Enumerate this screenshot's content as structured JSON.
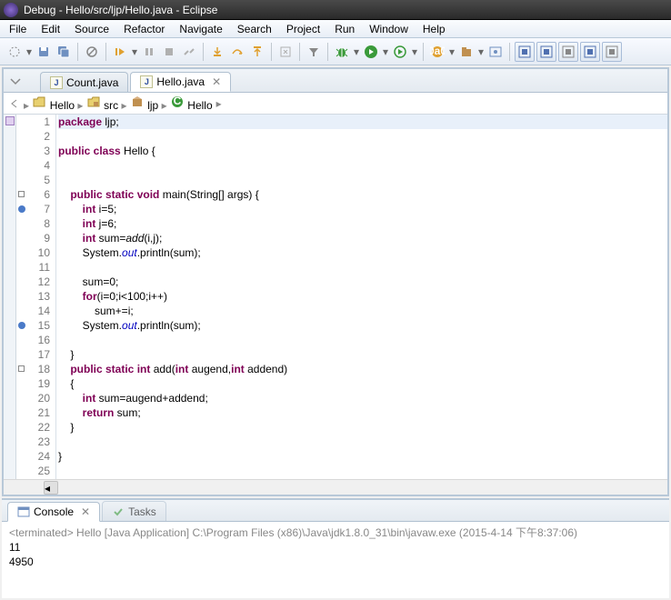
{
  "title": "Debug - Hello/src/ljp/Hello.java - Eclipse",
  "menu": [
    "File",
    "Edit",
    "Source",
    "Refactor",
    "Navigate",
    "Search",
    "Project",
    "Run",
    "Window",
    "Help"
  ],
  "tabs": [
    {
      "label": "Count.java",
      "active": false
    },
    {
      "label": "Hello.java",
      "active": true
    }
  ],
  "breadcrumb": [
    {
      "icon": "project",
      "label": "Hello"
    },
    {
      "icon": "package-root",
      "label": "src"
    },
    {
      "icon": "package",
      "label": "ljp"
    },
    {
      "icon": "class",
      "label": "Hello"
    }
  ],
  "code": {
    "lines": [
      {
        "n": 1,
        "html": "<span class='k'>package</span> ljp;",
        "hl": true
      },
      {
        "n": 2,
        "html": ""
      },
      {
        "n": 3,
        "html": "<span class='k'>public class</span> Hello {"
      },
      {
        "n": 4,
        "html": ""
      },
      {
        "n": 5,
        "html": ""
      },
      {
        "n": 6,
        "html": "    <span class='k'>public static void</span> main(String[] args) {",
        "fold": true
      },
      {
        "n": 7,
        "html": "        <span class='k'>int</span> i=5;",
        "bp": true
      },
      {
        "n": 8,
        "html": "        <span class='k'>int</span> j=6;"
      },
      {
        "n": 9,
        "html": "        <span class='k'>int</span> sum=<span class='m'>add</span>(i,j);"
      },
      {
        "n": 10,
        "html": "        System.<span class='s'>out</span>.println(sum);"
      },
      {
        "n": 11,
        "html": ""
      },
      {
        "n": 12,
        "html": "        sum=0;"
      },
      {
        "n": 13,
        "html": "        <span class='k'>for</span>(i=0;i&lt;100;i++)"
      },
      {
        "n": 14,
        "html": "            sum+=i;"
      },
      {
        "n": 15,
        "html": "        System.<span class='s'>out</span>.println(sum);",
        "bp": true
      },
      {
        "n": 16,
        "html": ""
      },
      {
        "n": 17,
        "html": "    }"
      },
      {
        "n": 18,
        "html": "    <span class='k'>public static int</span> add(<span class='k'>int</span> augend,<span class='k'>int</span> addend)",
        "fold": true
      },
      {
        "n": 19,
        "html": "    {"
      },
      {
        "n": 20,
        "html": "        <span class='k'>int</span> sum=augend+addend;"
      },
      {
        "n": 21,
        "html": "        <span class='k'>return</span> sum;"
      },
      {
        "n": 22,
        "html": "    }"
      },
      {
        "n": 23,
        "html": ""
      },
      {
        "n": 24,
        "html": "}"
      },
      {
        "n": 25,
        "html": ""
      }
    ]
  },
  "console": {
    "tab_label": "Console",
    "tasks_label": "Tasks",
    "header": "<terminated> Hello [Java Application] C:\\Program Files (x86)\\Java\\jdk1.8.0_31\\bin\\javaw.exe (2015-4-14 下午8:37:06)",
    "output": [
      "11",
      "4950"
    ]
  },
  "toolbar_icons": [
    {
      "name": "none-icon",
      "color": "#888",
      "dd": true,
      "shape": "none"
    },
    {
      "name": "save-icon",
      "color": "#7090c0",
      "shape": "disk"
    },
    {
      "name": "save-all-icon",
      "color": "#7090c0",
      "dd": false,
      "shape": "disks"
    },
    {
      "sep": true
    },
    {
      "name": "skip-bp-icon",
      "color": "#888",
      "shape": "circle-slash"
    },
    {
      "sep": true
    },
    {
      "name": "resume-icon",
      "color": "#e0a030",
      "dd": true,
      "shape": "play-bar"
    },
    {
      "name": "suspend-icon",
      "color": "#b0b0b0",
      "shape": "pause"
    },
    {
      "name": "terminate-icon",
      "color": "#b0b0b0",
      "shape": "stop"
    },
    {
      "name": "disconnect-icon",
      "color": "#b0b0b0",
      "shape": "disc"
    },
    {
      "sep": true
    },
    {
      "name": "step-into-icon",
      "color": "#e0a030",
      "shape": "arrow-down-in"
    },
    {
      "name": "step-over-icon",
      "color": "#e0a030",
      "shape": "arrow-over"
    },
    {
      "name": "step-return-icon",
      "color": "#e0a030",
      "shape": "arrow-up-out"
    },
    {
      "sep": true
    },
    {
      "name": "drop-frame-icon",
      "color": "#b0b0b0",
      "shape": "frame"
    },
    {
      "sep": true
    },
    {
      "name": "step-filter-icon",
      "color": "#888",
      "shape": "filter"
    },
    {
      "sep": true
    },
    {
      "name": "debug-icon",
      "color": "#3a9a3a",
      "dd": true,
      "shape": "bug"
    },
    {
      "name": "run-icon",
      "color": "#3a9a3a",
      "dd": true,
      "shape": "play"
    },
    {
      "name": "run-last-icon",
      "color": "#3a9a3a",
      "dd": true,
      "shape": "play-tool"
    },
    {
      "sep": true
    },
    {
      "name": "new-class-icon",
      "color": "#e0a030",
      "dd": true,
      "shape": "class"
    },
    {
      "name": "new-package-icon",
      "color": "#c09050",
      "dd": true,
      "shape": "package"
    },
    {
      "name": "open-type-icon",
      "color": "#7090c0",
      "shape": "open-type"
    },
    {
      "sep": true
    },
    {
      "name": "quick-access-icon",
      "color": "#5070b0",
      "shape": "box",
      "boxed": true
    },
    {
      "name": "java-persp-icon",
      "color": "#5070b0",
      "shape": "box",
      "boxed": true
    },
    {
      "name": "outline-btn-icon",
      "color": "#888",
      "shape": "box",
      "boxed": true
    },
    {
      "name": "debug-persp-icon",
      "color": "#5070b0",
      "shape": "box",
      "boxed": true
    },
    {
      "name": "team-persp-icon",
      "color": "#888",
      "shape": "box",
      "boxed": true
    }
  ]
}
